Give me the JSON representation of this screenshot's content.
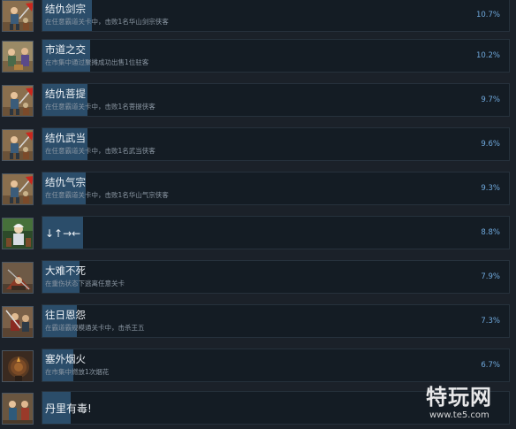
{
  "achievements": [
    {
      "title": "结仇剑宗",
      "desc": "在任意霸道关卡中，击败1名华山剑宗侠客",
      "percent": "10.7%",
      "fill_fraction": 0.107,
      "icon": "swordsman-icon"
    },
    {
      "title": "市道之交",
      "desc": "在市集中通过聚摊成功出售1位驻客",
      "percent": "10.2%",
      "fill_fraction": 0.102,
      "icon": "merchant-icon"
    },
    {
      "title": "结仇菩提",
      "desc": "在任意霸道关卡中，击败1名菩提侠客",
      "percent": "9.7%",
      "fill_fraction": 0.097,
      "icon": "swordsman-icon"
    },
    {
      "title": "结仇武当",
      "desc": "在任意霸道关卡中，击败1名武当侠客",
      "percent": "9.6%",
      "fill_fraction": 0.096,
      "icon": "swordsman-icon"
    },
    {
      "title": "结仇气宗",
      "desc": "在任意霸道关卡中，击败1名华山气宗侠客",
      "percent": "9.3%",
      "fill_fraction": 0.093,
      "icon": "swordsman-icon"
    },
    {
      "title": "↓↑→←",
      "desc": "",
      "percent": "8.8%",
      "fill_fraction": 0.088,
      "icon": "hero-portrait-icon"
    },
    {
      "title": "大难不死",
      "desc": "在重伤状态下逃离任意关卡",
      "percent": "7.9%",
      "fill_fraction": 0.079,
      "icon": "fallen-hero-icon"
    },
    {
      "title": "往日恩怨",
      "desc": "在霸道霸规模通关卡中，击杀王五",
      "percent": "7.3%",
      "fill_fraction": 0.073,
      "icon": "warrior-icon"
    },
    {
      "title": "塞外烟火",
      "desc": "在市集中燃放1次烟花",
      "percent": "6.7%",
      "fill_fraction": 0.067,
      "icon": "firework-icon"
    },
    {
      "title": "丹里有毒!",
      "desc": "",
      "percent": "",
      "fill_fraction": 0.06,
      "icon": "duo-portrait-icon"
    }
  ],
  "watermark": {
    "brand": "特玩网",
    "site": "www.te5.com"
  },
  "colors": {
    "background": "#1b2129",
    "bar": "#141c24",
    "fill": "#2b4d6a",
    "percent": "#6fa8dc"
  }
}
